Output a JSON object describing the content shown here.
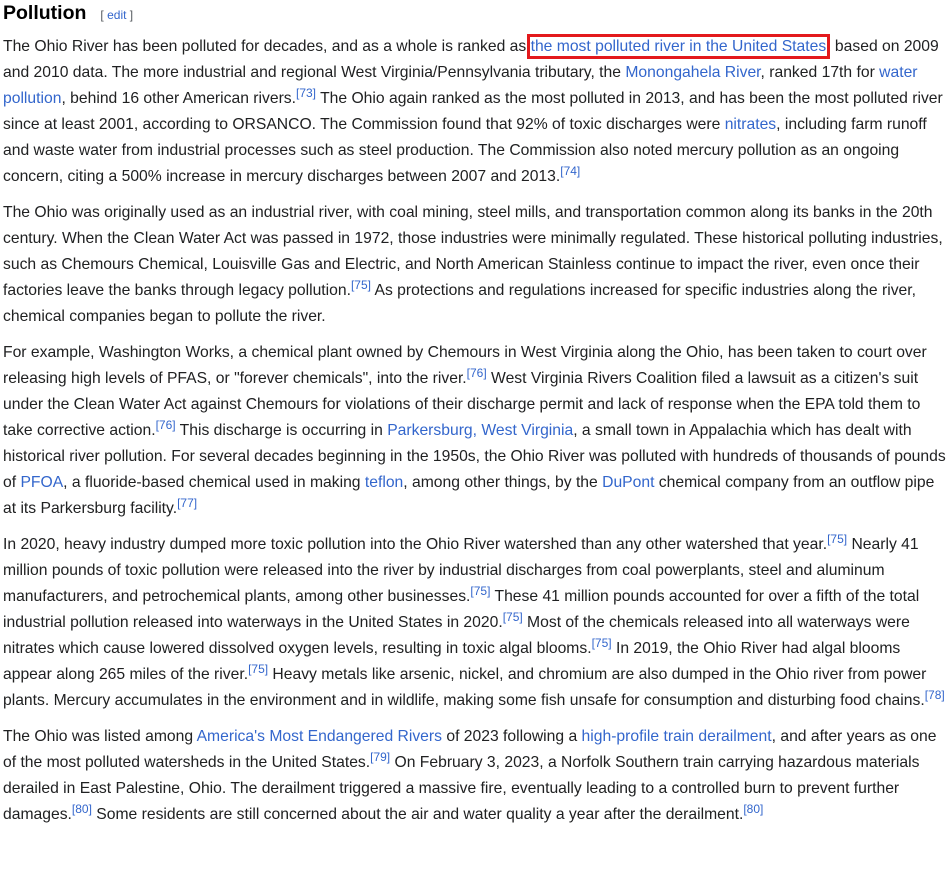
{
  "section": {
    "title": "Pollution",
    "edit_open": "[",
    "edit_label": "edit",
    "edit_close": "]"
  },
  "paragraphs": [
    {
      "id": "p1",
      "runs": [
        {
          "t": "text",
          "v": "The Ohio River has been polluted for decades, and as a whole is ranked as "
        },
        {
          "t": "link",
          "v": "the most polluted river in the United States",
          "name": "link-most-polluted-river",
          "highlight": true
        },
        {
          "t": "text",
          "v": ", based on 2009 and 2010 data. The more industrial and regional West Virginia/Pennsylvania tributary, the "
        },
        {
          "t": "link",
          "v": "Monongahela River",
          "name": "link-monongahela-river"
        },
        {
          "t": "text",
          "v": ", ranked 17th for "
        },
        {
          "t": "link",
          "v": "water pollution",
          "name": "link-water-pollution"
        },
        {
          "t": "text",
          "v": ", behind 16 other American rivers."
        },
        {
          "t": "ref",
          "v": "[73]"
        },
        {
          "t": "text",
          "v": " The Ohio again ranked as the most polluted in 2013, and has been the most polluted river since at least 2001, according to ORSANCO. The Commission found that 92% of toxic discharges were "
        },
        {
          "t": "link",
          "v": "nitrates",
          "name": "link-nitrates"
        },
        {
          "t": "text",
          "v": ", including farm runoff and waste water from industrial processes such as steel production. The Commission also noted mercury pollution as an ongoing concern, citing a 500% increase in mercury discharges between 2007 and 2013."
        },
        {
          "t": "ref",
          "v": "[74]"
        }
      ]
    },
    {
      "id": "p2",
      "runs": [
        {
          "t": "text",
          "v": "The Ohio was originally used as an industrial river, with coal mining, steel mills, and transportation common along its banks in the 20th century. When the Clean Water Act was passed in 1972, those industries were minimally regulated. These historical polluting industries, such as Chemours Chemical, Louisville Gas and Electric, and North American Stainless continue to impact the river, even once their factories leave the banks through legacy pollution."
        },
        {
          "t": "ref",
          "v": "[75]"
        },
        {
          "t": "text",
          "v": " As protections and regulations increased for specific industries along the river, chemical companies began to pollute the river."
        }
      ]
    },
    {
      "id": "p3",
      "runs": [
        {
          "t": "text",
          "v": "For example, Washington Works, a chemical plant owned by Chemours in West Virginia along the Ohio, has been taken to court over releasing high levels of PFAS, or \"forever chemicals\", into the river."
        },
        {
          "t": "ref",
          "v": "[76]"
        },
        {
          "t": "text",
          "v": " West Virginia Rivers Coalition filed a lawsuit as a citizen's suit under the Clean Water Act against Chemours for violations of their discharge permit and lack of response when the EPA told them to take corrective action."
        },
        {
          "t": "ref",
          "v": "[76]"
        },
        {
          "t": "text",
          "v": " This discharge is occurring in "
        },
        {
          "t": "link",
          "v": "Parkersburg, West Virginia",
          "name": "link-parkersburg"
        },
        {
          "t": "text",
          "v": ", a small town in Appalachia which has dealt with historical river pollution. For several decades beginning in the 1950s, the Ohio River was polluted with hundreds of thousands of pounds of "
        },
        {
          "t": "link",
          "v": "PFOA",
          "name": "link-pfoa"
        },
        {
          "t": "text",
          "v": ", a fluoride-based chemical used in making "
        },
        {
          "t": "link",
          "v": "teflon",
          "name": "link-teflon"
        },
        {
          "t": "text",
          "v": ", among other things, by the "
        },
        {
          "t": "link",
          "v": "DuPont",
          "name": "link-dupont"
        },
        {
          "t": "text",
          "v": " chemical company from an outflow pipe at its Parkersburg facility."
        },
        {
          "t": "ref",
          "v": "[77]"
        }
      ]
    },
    {
      "id": "p4",
      "runs": [
        {
          "t": "text",
          "v": "In 2020, heavy industry dumped more toxic pollution into the Ohio River watershed than any other watershed that year."
        },
        {
          "t": "ref",
          "v": "[75]"
        },
        {
          "t": "text",
          "v": " Nearly 41 million pounds of toxic pollution were released into the river by industrial discharges from coal powerplants, steel and aluminum manufacturers, and petrochemical plants, among other businesses."
        },
        {
          "t": "ref",
          "v": "[75]"
        },
        {
          "t": "text",
          "v": " These 41 million pounds accounted for over a fifth of the total industrial pollution released into waterways in the United States in 2020."
        },
        {
          "t": "ref",
          "v": "[75]"
        },
        {
          "t": "text",
          "v": " Most of the chemicals released into all waterways were nitrates which cause lowered dissolved oxygen levels, resulting in toxic algal blooms."
        },
        {
          "t": "ref",
          "v": "[75]"
        },
        {
          "t": "text",
          "v": " In 2019, the Ohio River had algal blooms appear along 265 miles of the river."
        },
        {
          "t": "ref",
          "v": "[75]"
        },
        {
          "t": "text",
          "v": " Heavy metals like arsenic, nickel, and chromium are also dumped in the Ohio river from power plants. Mercury accumulates in the environment and in wildlife, making some fish unsafe for consumption and disturbing food chains."
        },
        {
          "t": "ref",
          "v": "[78]"
        }
      ]
    },
    {
      "id": "p5",
      "runs": [
        {
          "t": "text",
          "v": "The Ohio was listed among "
        },
        {
          "t": "link",
          "v": "America's Most Endangered Rivers",
          "name": "link-most-endangered-rivers"
        },
        {
          "t": "text",
          "v": " of 2023 following a "
        },
        {
          "t": "link",
          "v": "high-profile train derailment",
          "name": "link-train-derailment"
        },
        {
          "t": "text",
          "v": ", and after years as one of the most polluted watersheds in the United States."
        },
        {
          "t": "ref",
          "v": "[79]"
        },
        {
          "t": "text",
          "v": " On February 3, 2023, a Norfolk Southern train carrying hazardous materials derailed in East Palestine, Ohio. The derailment triggered a massive fire, eventually leading to a controlled burn to prevent further damages."
        },
        {
          "t": "ref",
          "v": "[80]"
        },
        {
          "t": "text",
          "v": " Some residents are still concerned about the air and water quality a year after the derailment."
        },
        {
          "t": "ref",
          "v": "[80]"
        }
      ]
    }
  ]
}
